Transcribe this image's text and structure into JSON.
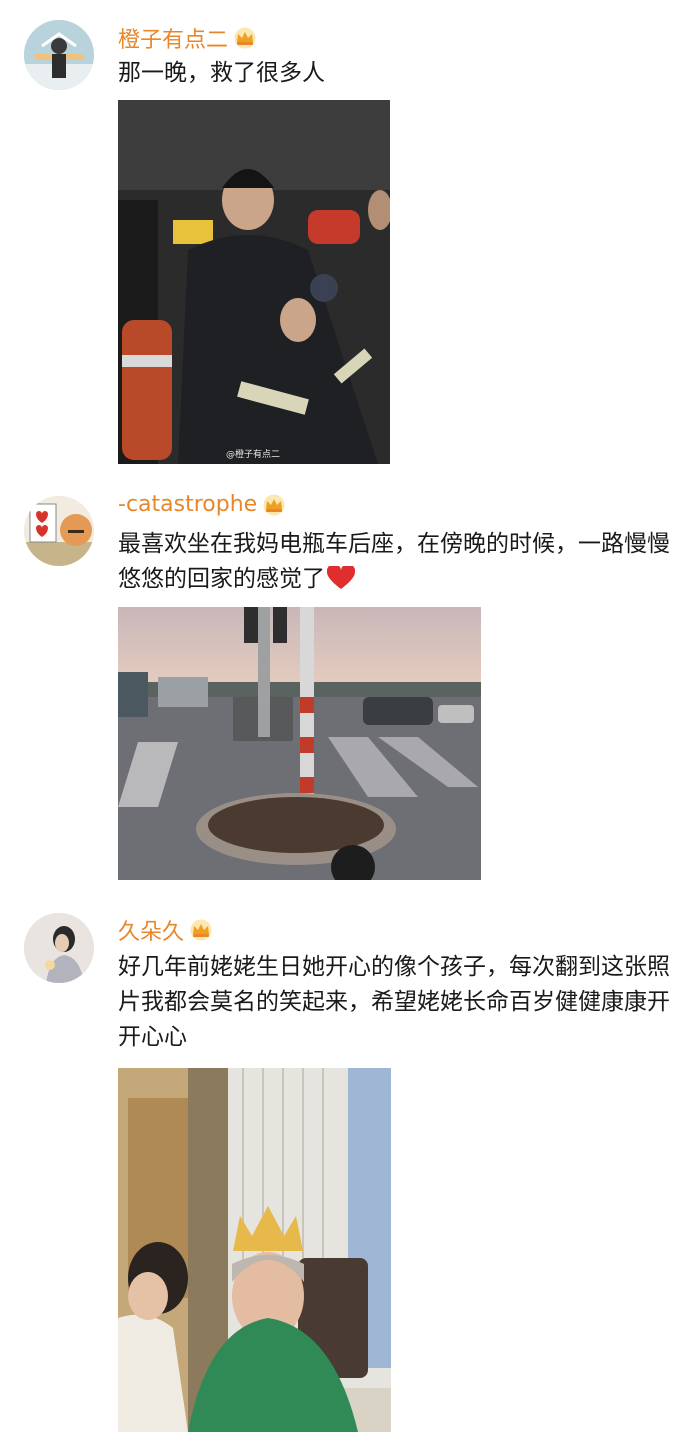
{
  "comments": [
    {
      "username": "橙子有点二",
      "text": "那一晚，救了很多人",
      "avatar_icon": "avatar-anime-figure",
      "badge_icon": "crown-icon",
      "photo_desc_icon": "firefighter-photo",
      "watermark": "@橙子有点二"
    },
    {
      "username": "-catastrophe",
      "text": "最喜欢坐在我妈电瓶车后座，在傍晚的时候，一路慢慢悠悠的回家的感觉了",
      "avatar_icon": "avatar-cartoon-hearts",
      "badge_icon": "crown-icon",
      "emoji_icon": "red-heart-icon",
      "photo_desc_icon": "street-dusk-photo"
    },
    {
      "username": "久朵久",
      "text": "好几年前姥姥生日她开心的像个孩子，每次翻到这张照片我都会莫名的笑起来，希望姥姥长命百岁健健康康开开心心",
      "avatar_icon": "avatar-girl",
      "badge_icon": "crown-icon",
      "photo_desc_icon": "grandma-birthday-photo"
    }
  ],
  "colors": {
    "username": "#e8862a",
    "text": "#1a1a1a",
    "crown": "#f0a020",
    "heart": "#e02d2d"
  }
}
